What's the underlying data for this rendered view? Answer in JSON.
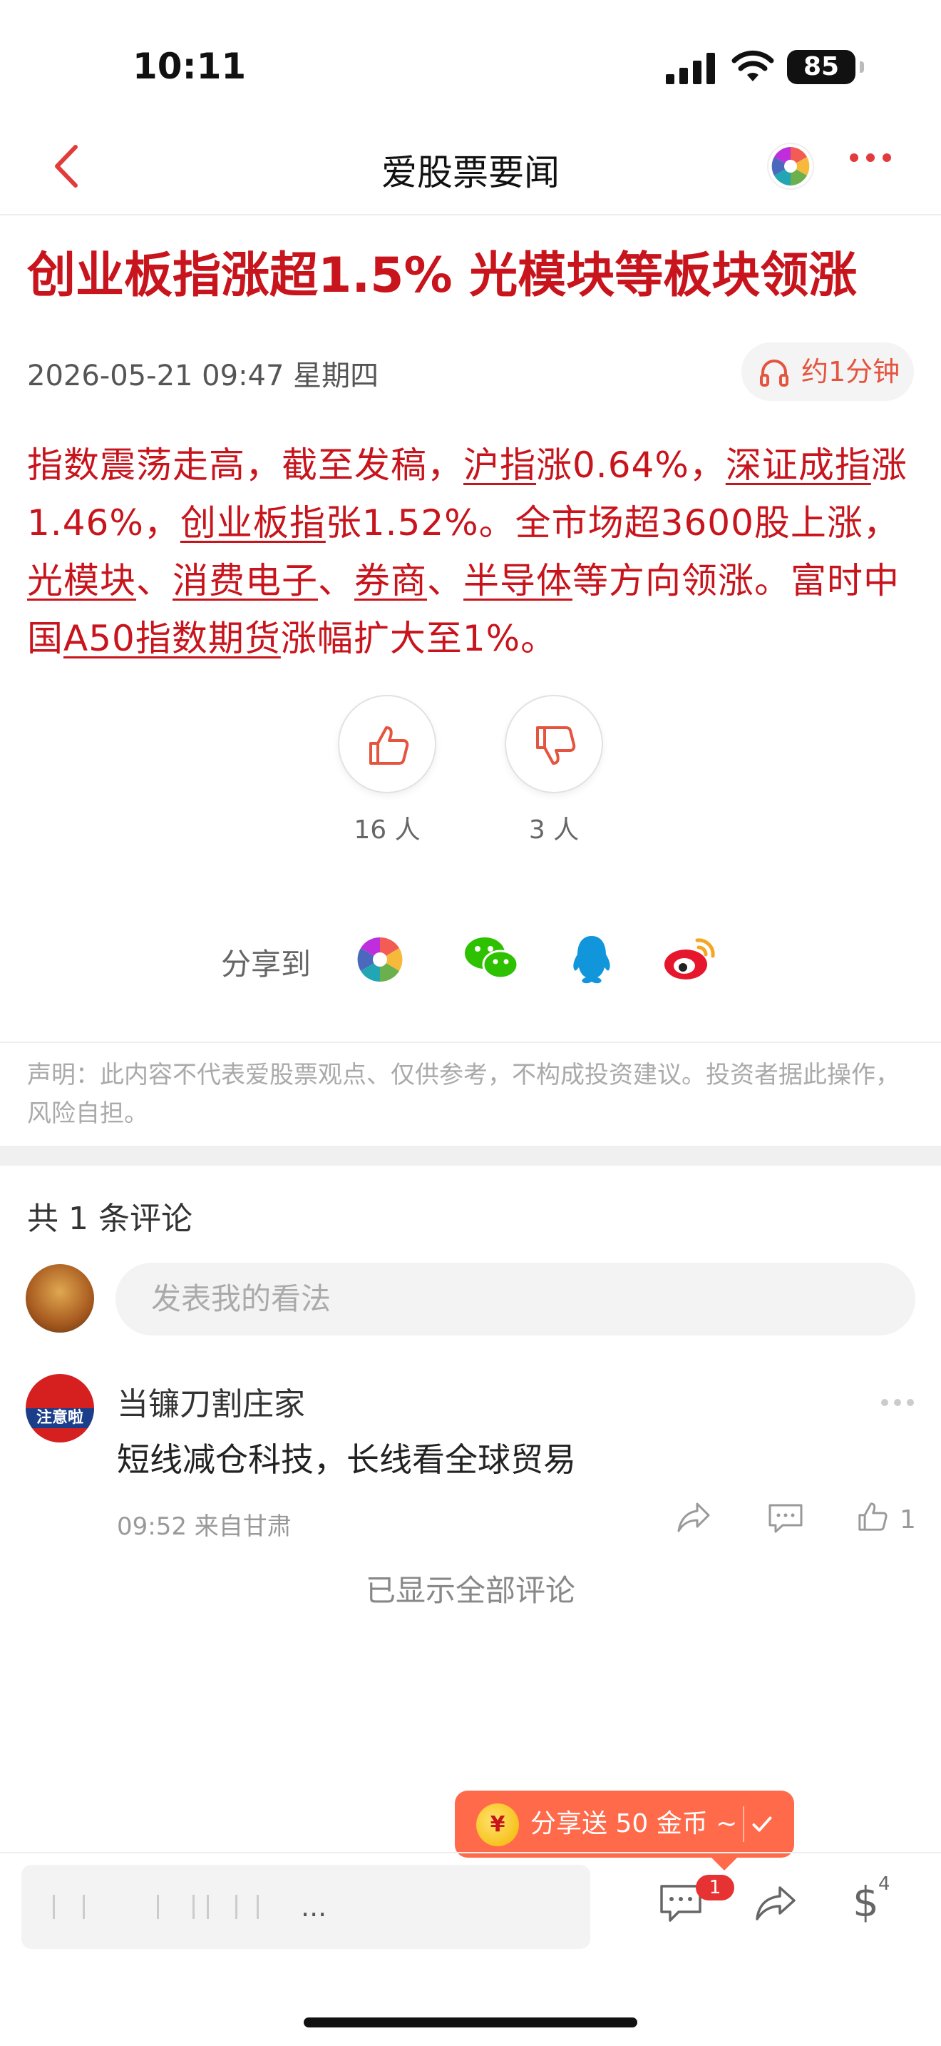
{
  "status_bar": {
    "time": "10:11",
    "battery": "85"
  },
  "nav": {
    "title": "爱股票要闻"
  },
  "article": {
    "headline": "创业板指涨超1.5% 光模块等板块领涨",
    "date": "2026-05-21 09:47 星期四",
    "audio_label": "约1分钟",
    "body": {
      "t1": "指数震荡走高，截至发稿，",
      "l1": "沪指",
      "t2": "涨0.64%，",
      "l2": "深证成指",
      "t3": "涨1.46%，",
      "l3": "创业板指",
      "t4": "张1.52%。全市场超3600股上涨，",
      "l4": "光模块",
      "t5": "、",
      "l5": "消费电子",
      "t6": "、",
      "l6": "券商",
      "t7": "、",
      "l7": "半导体",
      "t8": "等方向领涨。富时中国",
      "l8": "A50指数期货",
      "t9": "涨幅扩大至1%。"
    },
    "like_count": "16 人",
    "dislike_count": "3 人",
    "share_label": "分享到",
    "disclaimer": "声明：此内容不代表爱股票观点、仅供参考，不构成投资建议。投资者据此操作，风险自担。"
  },
  "comments": {
    "count_label": "共 1 条评论",
    "input_placeholder": "发表我的看法",
    "items": [
      {
        "user": "当镰刀割庄家",
        "avatar_text": "注意啦",
        "text": "短线减仓科技，长线看全球贸易",
        "meta": "09:52 来自甘肃",
        "likes": "1"
      }
    ],
    "all_shown": "已显示全部评论"
  },
  "promo": {
    "label": "分享送 50 金币 ~",
    "coin_symbol": "¥"
  },
  "bottom_bar": {
    "draft_text": "...",
    "comment_badge": "1",
    "reward_symbol": "$",
    "reward_count": "4"
  },
  "colors": {
    "accent": "#c8141c",
    "nav_red": "#e33b3b",
    "promo": "#ff6a4a"
  }
}
